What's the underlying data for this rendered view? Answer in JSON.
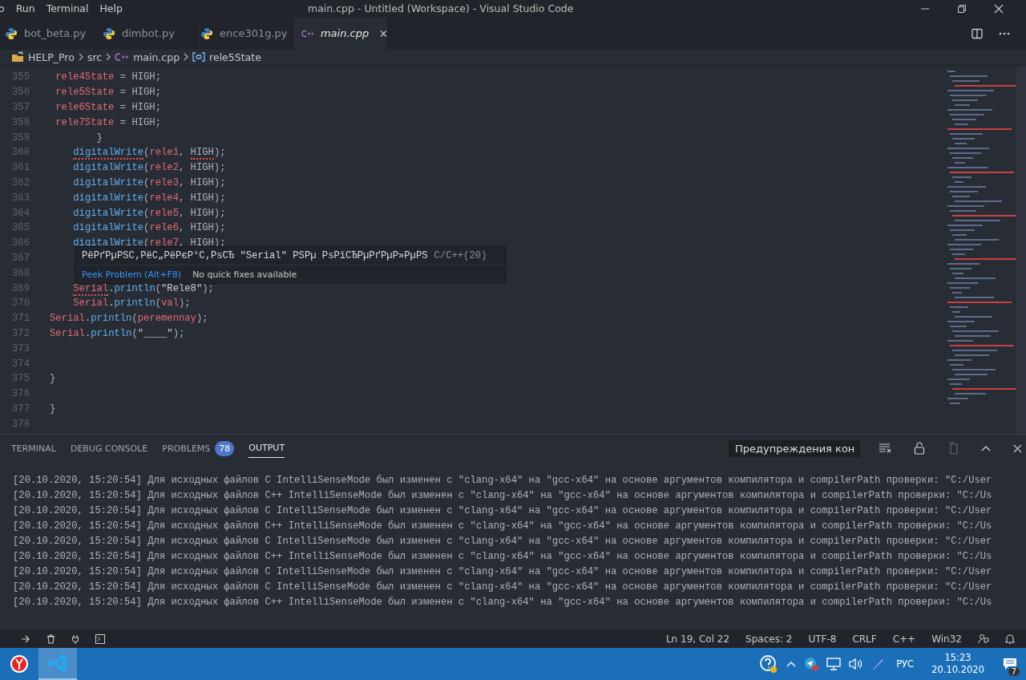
{
  "menu": [
    "o",
    "Run",
    "Terminal",
    "Help"
  ],
  "window": {
    "title": "main.cpp - Untitled (Workspace) - Visual Studio Code"
  },
  "tabs": [
    {
      "label": "bot_beta.py",
      "kind": "python",
      "selected": false,
      "preview": false
    },
    {
      "label": "dimbot.py",
      "kind": "python",
      "selected": false,
      "preview": false
    },
    {
      "label": "ence301g.py",
      "kind": "python",
      "selected": false,
      "preview": false
    },
    {
      "label": "main.cpp",
      "kind": "cpp",
      "selected": true,
      "preview": true
    }
  ],
  "breadcrumbs": [
    {
      "label": "HELP_Pro",
      "kind": "folder"
    },
    {
      "label": "src",
      "kind": "plain"
    },
    {
      "label": "main.cpp",
      "kind": "cpp"
    },
    {
      "label": "rele5State",
      "kind": "variable"
    }
  ],
  "editor": {
    "lines": [
      {
        "number": "355",
        "kind": "assign",
        "tokens": [
          {
            "text": "rele4State",
            "kind": "var",
            "error": false
          },
          {
            "text": " = HIGH;",
            "kind": "plain",
            "error": false
          }
        ]
      },
      {
        "number": "356",
        "kind": "assign",
        "tokens": [
          {
            "text": "rele5State",
            "kind": "var",
            "error": false
          },
          {
            "text": " = HIGH;",
            "kind": "plain",
            "error": false
          }
        ]
      },
      {
        "number": "357",
        "kind": "assign",
        "tokens": [
          {
            "text": "rele6State",
            "kind": "var",
            "error": false
          },
          {
            "text": " = HIGH;",
            "kind": "plain",
            "error": false
          }
        ]
      },
      {
        "number": "358",
        "kind": "assign",
        "tokens": [
          {
            "text": "rele7State",
            "kind": "var",
            "error": false
          },
          {
            "text": " = HIGH;",
            "kind": "plain",
            "error": false
          }
        ]
      },
      {
        "number": "359",
        "kind": "brace",
        "tokens": [
          {
            "text": "}",
            "kind": "plain",
            "error": false
          }
        ]
      },
      {
        "number": "360",
        "kind": "nested",
        "tokens": [
          {
            "text": "digitalWrite",
            "kind": "fn",
            "error": true
          },
          {
            "text": "(",
            "kind": "plain",
            "error": false
          },
          {
            "text": "rele1",
            "kind": "var",
            "error": false
          },
          {
            "text": ", ",
            "kind": "plain",
            "error": false
          },
          {
            "text": "HIGH",
            "kind": "plain",
            "error": true
          },
          {
            "text": ");",
            "kind": "plain",
            "error": false
          }
        ]
      },
      {
        "number": "361",
        "kind": "nested",
        "tokens": [
          {
            "text": "digitalWrite",
            "kind": "fn",
            "error": false
          },
          {
            "text": "(",
            "kind": "plain",
            "error": false
          },
          {
            "text": "rele2",
            "kind": "var",
            "error": false
          },
          {
            "text": ", HIGH);",
            "kind": "plain",
            "error": false
          }
        ]
      },
      {
        "number": "362",
        "kind": "nested",
        "tokens": [
          {
            "text": "digitalWrite",
            "kind": "fn",
            "error": false
          },
          {
            "text": "(",
            "kind": "plain",
            "error": false
          },
          {
            "text": "rele3",
            "kind": "var",
            "error": false
          },
          {
            "text": ", HIGH);",
            "kind": "plain",
            "error": false
          }
        ]
      },
      {
        "number": "363",
        "kind": "nested",
        "tokens": [
          {
            "text": "digitalWrite",
            "kind": "fn",
            "error": false
          },
          {
            "text": "(",
            "kind": "plain",
            "error": false
          },
          {
            "text": "rele4",
            "kind": "var",
            "error": false
          },
          {
            "text": ", HIGH);",
            "kind": "plain",
            "error": false
          }
        ]
      },
      {
        "number": "364",
        "kind": "nested",
        "tokens": [
          {
            "text": "digitalWrite",
            "kind": "fn",
            "error": false
          },
          {
            "text": "(",
            "kind": "plain",
            "error": false
          },
          {
            "text": "rele5",
            "kind": "var",
            "error": false
          },
          {
            "text": ", HIGH);",
            "kind": "plain",
            "error": false
          }
        ]
      },
      {
        "number": "365",
        "kind": "nested",
        "tokens": [
          {
            "text": "digitalWrite",
            "kind": "fn",
            "error": false
          },
          {
            "text": "(",
            "kind": "plain",
            "error": false
          },
          {
            "text": "rele6",
            "kind": "var",
            "error": false
          },
          {
            "text": ", HIGH);",
            "kind": "plain",
            "error": false
          }
        ]
      },
      {
        "number": "366",
        "kind": "nested",
        "tokens": [
          {
            "text": "digitalWrite",
            "kind": "fn",
            "error": false
          },
          {
            "text": "(",
            "kind": "plain",
            "error": false
          },
          {
            "text": "rele7",
            "kind": "var",
            "error": false
          },
          {
            "text": ", HIGH);",
            "kind": "plain",
            "error": false
          }
        ]
      },
      {
        "number": "367"
      },
      {
        "number": "368"
      },
      {
        "number": "369",
        "kind": "nested",
        "tokens": [
          {
            "text": "Serial",
            "kind": "var",
            "error": true
          },
          {
            "text": ".",
            "kind": "plain",
            "error": false
          },
          {
            "text": "println",
            "kind": "fn",
            "error": false
          },
          {
            "text": "(",
            "kind": "plain",
            "error": false
          },
          {
            "text": "\"Rele8\"",
            "kind": "str",
            "error": false
          },
          {
            "text": ");",
            "kind": "plain",
            "error": false
          }
        ]
      },
      {
        "number": "370",
        "kind": "nested",
        "tokens": [
          {
            "text": "Serial",
            "kind": "var",
            "error": false
          },
          {
            "text": ".",
            "kind": "plain",
            "error": false
          },
          {
            "text": "println",
            "kind": "fn",
            "error": false
          },
          {
            "text": "(",
            "kind": "plain",
            "error": false
          },
          {
            "text": "val",
            "kind": "var",
            "error": false
          },
          {
            "text": ");",
            "kind": "plain",
            "error": false
          }
        ]
      },
      {
        "number": "371",
        "kind": "top",
        "tokens": [
          {
            "text": "Serial",
            "kind": "var",
            "error": false
          },
          {
            "text": ".",
            "kind": "plain",
            "error": false
          },
          {
            "text": "println",
            "kind": "fn",
            "error": false
          },
          {
            "text": "(",
            "kind": "plain",
            "error": false
          },
          {
            "text": "peremennay",
            "kind": "var",
            "error": false
          },
          {
            "text": ");",
            "kind": "plain",
            "error": false
          }
        ]
      },
      {
        "number": "372",
        "kind": "top",
        "tokens": [
          {
            "text": "Serial",
            "kind": "var",
            "error": false
          },
          {
            "text": ".",
            "kind": "plain",
            "error": false
          },
          {
            "text": "println",
            "kind": "fn",
            "error": false
          },
          {
            "text": "(",
            "kind": "plain",
            "error": false
          },
          {
            "text": "\"____\"",
            "kind": "str",
            "error": false
          },
          {
            "text": ");",
            "kind": "plain",
            "error": false
          }
        ]
      },
      {
        "number": "373"
      },
      {
        "number": "374"
      },
      {
        "number": "375",
        "kind": "top",
        "tokens": [
          {
            "text": "}",
            "kind": "plain",
            "error": false
          }
        ]
      },
      {
        "number": "376"
      },
      {
        "number": "377",
        "kind": "top",
        "tokens": [
          {
            "text": "}",
            "kind": "plain",
            "error": false
          }
        ]
      },
      {
        "number": "378"
      }
    ]
  },
  "hover": {
    "message": "PëPґPµPSC‚PëC„PëPєP°C‚PsCЂ \"Serial\" PSPµ PsPïCЂPµPґPµP»PµPS",
    "source": "C/C++(20)",
    "actions": [
      {
        "label": "Peek Problem (Alt+F8)",
        "kind": "link"
      },
      {
        "label": "No quick fixes available",
        "kind": "note"
      }
    ]
  },
  "panel": {
    "tabs": [
      {
        "label": "TERMINAL",
        "selected": false
      },
      {
        "label": "DEBUG CONSOLE",
        "selected": false
      },
      {
        "label": "PROBLEMS",
        "badge": "78",
        "selected": false
      },
      {
        "label": "OUTPUT",
        "selected": true
      }
    ],
    "dropdown": "Предупреждения кон",
    "output": [
      "[20.10.2020, 15:20:54] Для исходных файлов C IntelliSenseMode был изменен с \"clang-x64\" на \"gcc-x64\" на основе аргументов компилятора и compilerPath проверки: \"C:/User",
      "[20.10.2020, 15:20:54] Для исходных файлов C++ IntelliSenseMode был изменен с \"clang-x64\" на \"gcc-x64\" на основе аргументов компилятора и compilerPath проверки: \"C:/Us",
      "[20.10.2020, 15:20:54] Для исходных файлов C IntelliSenseMode был изменен с \"clang-x64\" на \"gcc-x64\" на основе аргументов компилятора и compilerPath проверки: \"C:/User",
      "[20.10.2020, 15:20:54] Для исходных файлов C++ IntelliSenseMode был изменен с \"clang-x64\" на \"gcc-x64\" на основе аргументов компилятора и compilerPath проверки: \"C:/Us",
      "[20.10.2020, 15:20:54] Для исходных файлов C IntelliSenseMode был изменен с \"clang-x64\" на \"gcc-x64\" на основе аргументов компилятора и compilerPath проверки: \"C:/User",
      "[20.10.2020, 15:20:54] Для исходных файлов C++ IntelliSenseMode был изменен с \"clang-x64\" на \"gcc-x64\" на основе аргументов компилятора и compilerPath проверки: \"C:/Us",
      "[20.10.2020, 15:20:54] Для исходных файлов C IntelliSenseMode был изменен с \"clang-x64\" на \"gcc-x64\" на основе аргументов компилятора и compilerPath проверки: \"C:/User",
      "[20.10.2020, 15:20:54] Для исходных файлов C IntelliSenseMode был изменен с \"clang-x64\" на \"gcc-x64\" на основе аргументов компилятора и compilerPath проверки: \"C:/User",
      "[20.10.2020, 15:20:54] Для исходных файлов C++ IntelliSenseMode был изменен с \"clang-x64\" на \"gcc-x64\" на основе аргументов компилятора и compilerPath проверки: \"C:/Us"
    ]
  },
  "status_bar": {
    "items": [
      "Ln 19, Col 22",
      "Spaces: 2",
      "UTF-8",
      "CRLF",
      "C++",
      "Win32"
    ]
  },
  "taskbar": {
    "language": "РУС",
    "time": "15:23",
    "date": "20.10.2020",
    "notifications": "7"
  }
}
